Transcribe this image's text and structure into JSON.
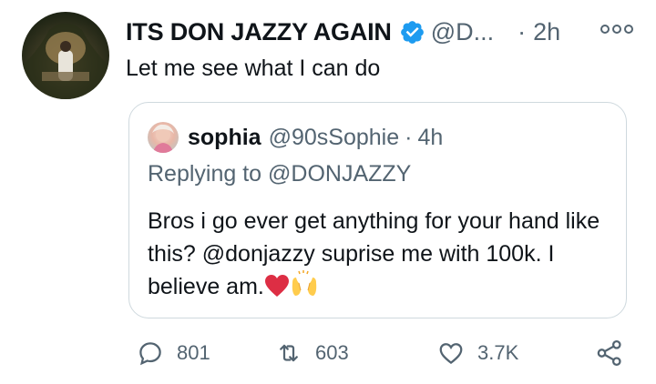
{
  "tweet": {
    "author_name": "ITS DON JAZZY AGAIN",
    "handle": "@D...",
    "separator": "·",
    "time": "2h",
    "text": "Let me see what I can do",
    "verified": true
  },
  "quote": {
    "name": "sophia",
    "handle": "@90sSophie",
    "separator": "·",
    "time": "4h",
    "replying_to": "Replying to @DONJAZZY",
    "body": "Bros i go ever get anything for your hand like this? @donjazzy suprise me with 100k. I believe am."
  },
  "actions": {
    "replies": "801",
    "retweets": "603",
    "likes": "3.7K"
  },
  "colors": {
    "verified_blue": "#1d9bf0",
    "secondary_text": "#536471",
    "border": "#cfd9de"
  }
}
